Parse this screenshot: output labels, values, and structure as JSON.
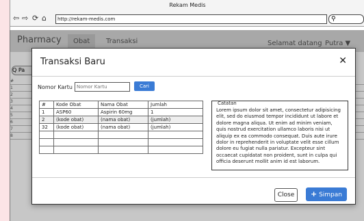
{
  "browser": {
    "title": "Rekam Medis",
    "url": "http://rekam-medis.com",
    "nav_icons": [
      "back-arrow-icon",
      "forward-arrow-icon",
      "refresh-icon",
      "home-icon"
    ]
  },
  "app": {
    "brand": "Pharmacy",
    "tabs": [
      {
        "label": "Obat",
        "active": true
      },
      {
        "label": "Transaksi",
        "active": false
      }
    ],
    "greeting": "Selamat datang",
    "user": "Putra ▼",
    "background_rows": [
      "1",
      "2",
      "3",
      "4",
      "5",
      "6",
      "7",
      "8"
    ],
    "background_header": "#",
    "background_search": "Q Pa"
  },
  "modal": {
    "title": "Transaksi Baru",
    "close_glyph": "✕",
    "card_label": "Nomor Kartu",
    "card_placeholder": "Nomor Kartu",
    "search_button": "Cari",
    "table": {
      "headers": [
        "#",
        "Kode Obat",
        "Nama Obat",
        "Jumlah"
      ],
      "rows": [
        [
          "1",
          "ASP60",
          "Aspirin 60mg",
          "1"
        ],
        [
          "2",
          "(kode obat)",
          "(nama obat)",
          "(jumlah)"
        ],
        [
          "32",
          "(kode obat)",
          "(nama obat)",
          "(jumlah)"
        ],
        [
          "",
          "",
          "",
          ""
        ],
        [
          "",
          "",
          "",
          ""
        ],
        [
          "",
          "",
          "",
          ""
        ]
      ]
    },
    "notes": {
      "legend": "Catatan",
      "text": "Lorem ipsum dolor sit amet, consectetur adipisicing elit, sed do eiusmod tempor incididunt ut labore et dolore magna aliqua. Ut enim ad minim veniam, quis nostrud exercitation ullamco laboris nisi ut aliquip ex ea commodo consequat. Duis aute irure dolor in reprehenderit in voluptate velit esse cillum dolore eu fugiat nulla pariatur. Excepteur sint occaecat cupidatat non proident, sunt in culpa qui officia deserunt mollit anim id est laborum."
    },
    "close_button": "Close",
    "save_button": "Simpan",
    "save_icon": "plus-icon"
  },
  "colors": {
    "accent": "#3a7bd5",
    "outer_background": "#fce4e6"
  }
}
